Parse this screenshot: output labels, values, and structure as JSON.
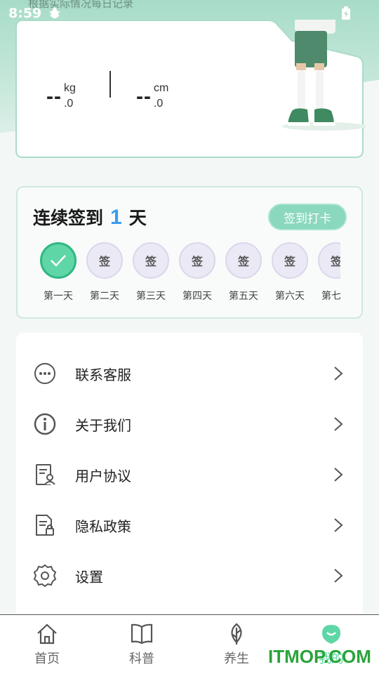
{
  "status_bar": {
    "time": "8:59",
    "hint": "根据实际情况每日记录"
  },
  "body_metrics": {
    "weight": {
      "value": "--",
      "unit": "kg",
      "decimal": ".0"
    },
    "height": {
      "value": "--",
      "unit": "cm",
      "decimal": ".0"
    }
  },
  "checkin": {
    "prefix": "连续签到",
    "count": "1",
    "suffix": "天",
    "button_label": "签到打卡",
    "days": [
      {
        "label": "第一天",
        "mark": "",
        "done": true
      },
      {
        "label": "第二天",
        "mark": "签",
        "done": false
      },
      {
        "label": "第三天",
        "mark": "签",
        "done": false
      },
      {
        "label": "第四天",
        "mark": "签",
        "done": false
      },
      {
        "label": "第五天",
        "mark": "签",
        "done": false
      },
      {
        "label": "第六天",
        "mark": "签",
        "done": false
      },
      {
        "label": "第七天",
        "mark": "签",
        "done": false
      }
    ]
  },
  "menu": {
    "items": [
      {
        "label": "联系客服",
        "icon": "chat-bubble-icon"
      },
      {
        "label": "关于我们",
        "icon": "info-icon"
      },
      {
        "label": "用户协议",
        "icon": "user-agreement-icon"
      },
      {
        "label": "隐私政策",
        "icon": "privacy-policy-icon"
      },
      {
        "label": "设置",
        "icon": "gear-icon"
      }
    ]
  },
  "tabbar": {
    "items": [
      {
        "label": "首页",
        "icon": "home-icon"
      },
      {
        "label": "科普",
        "icon": "book-icon"
      },
      {
        "label": "养生",
        "icon": "leaf-icon"
      },
      {
        "label": "我的",
        "icon": "profile-icon"
      }
    ]
  },
  "watermark": "ITMOP.COM",
  "colors": {
    "accent": "#5fd6a6",
    "count_blue": "#3c9cf0",
    "card_border": "#a9dcc7"
  }
}
